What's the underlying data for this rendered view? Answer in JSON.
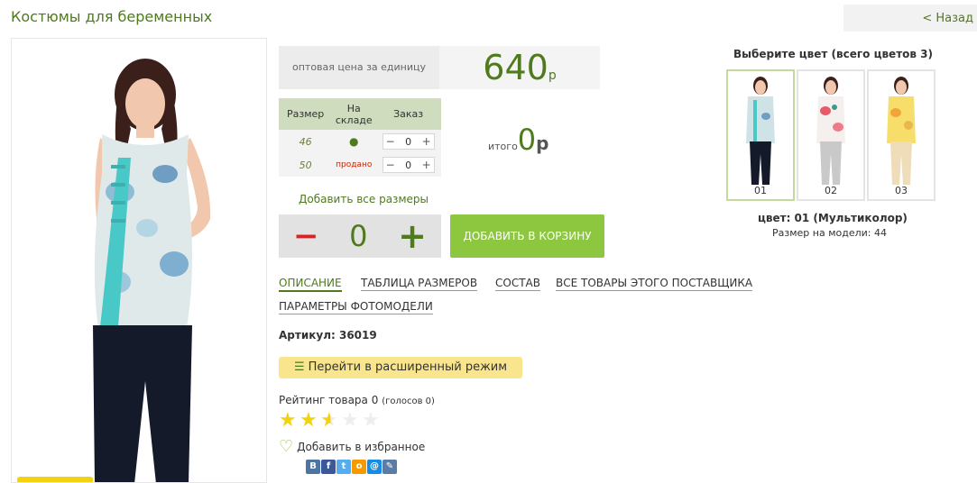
{
  "page": {
    "title": "Костюмы для беременных",
    "back_label": "< Назад"
  },
  "price": {
    "label": "оптовая цена за единицу",
    "value": "640",
    "currency": "р"
  },
  "size_table": {
    "headers": [
      "Размер",
      "На складе",
      "Заказ"
    ],
    "rows": [
      {
        "size": "46",
        "stock": "●",
        "qty": "0"
      },
      {
        "size": "50",
        "stock": "продано",
        "qty": "0"
      }
    ],
    "minus": "−",
    "plus": "+"
  },
  "total": {
    "label": "итого",
    "value": "0",
    "currency": "р"
  },
  "add_all_sizes": "Добавить все размеры",
  "quantity": {
    "minus": "−",
    "value": "0",
    "plus": "+"
  },
  "cart_button": "ДОБАВИТЬ В КОРЗИНУ",
  "tabs": [
    "ОПИСАНИЕ",
    "ТАБЛИЦА РАЗМЕРОВ",
    "СОСТАВ",
    "ВСЕ ТОВАРЫ ЭТОГО ПОСТАВЩИКА",
    "ПАРАМЕТРЫ ФОТОМОДЕЛИ"
  ],
  "article": "Артикул: 36019",
  "extended_mode": "Перейти в расширенный режим",
  "rating": {
    "label": "Рейтинг товара 0",
    "votes": "(голосов 0)",
    "stars_filled": 2.5,
    "stars_total": 5
  },
  "favorite": "Добавить в избранное",
  "social": [
    {
      "icon": "vk-icon",
      "glyph": "B",
      "color": "#4c75a3"
    },
    {
      "icon": "facebook-icon",
      "glyph": "f",
      "color": "#3b5998"
    },
    {
      "icon": "twitter-icon",
      "glyph": "t",
      "color": "#55acee"
    },
    {
      "icon": "odnoklassniki-icon",
      "glyph": "o",
      "color": "#f59a00"
    },
    {
      "icon": "mailru-icon",
      "glyph": "@",
      "color": "#168de2"
    },
    {
      "icon": "livejournal-icon",
      "glyph": "✎",
      "color": "#5b7ca6"
    }
  ],
  "colors": {
    "title": "Выберите цвет (всего цветов 3)",
    "thumbs": [
      "01",
      "02",
      "03"
    ],
    "selected_name": "цвет: 01 (Мультиколор)",
    "model_size": "Размер на модели: 44"
  },
  "palette": {
    "accent": "#4f7a1e",
    "button": "#8dc63f",
    "star": "#f2d30f"
  }
}
